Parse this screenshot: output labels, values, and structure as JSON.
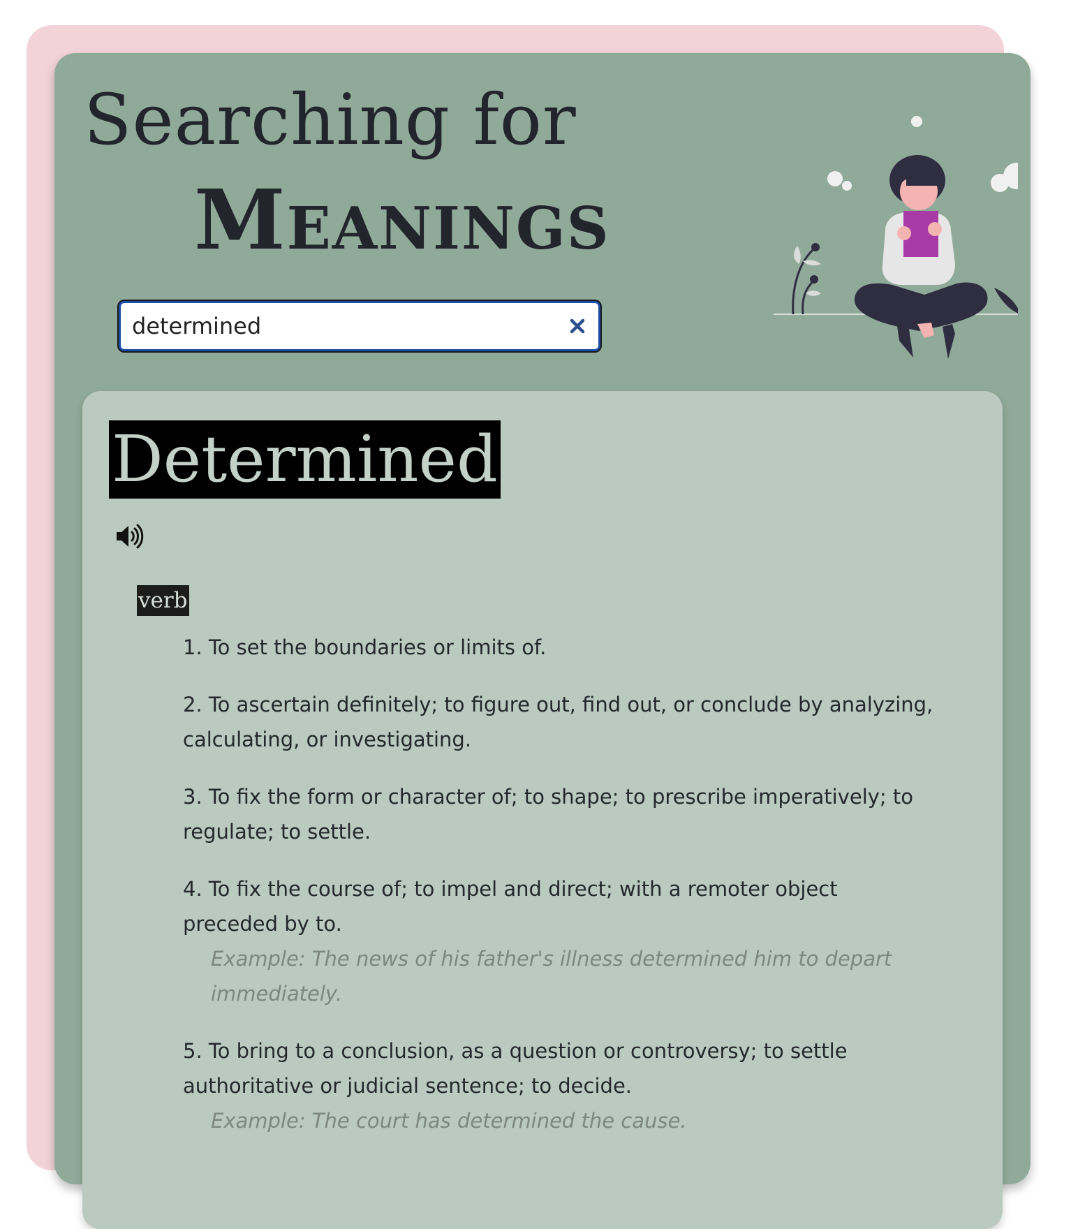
{
  "header": {
    "title_line1": "Searching for",
    "title_line2": "Meanings"
  },
  "search": {
    "value": "determined",
    "clear_icon": "close-icon"
  },
  "entry": {
    "word": "Determined",
    "audio_icon": "speaker-icon",
    "part_of_speech": "verb",
    "definitions": [
      {
        "text": "1. To set the boundaries or limits of.",
        "example": ""
      },
      {
        "text": "2. To ascertain definitely; to figure out, find out, or conclude by analyzing, calculating, or investigating.",
        "example": ""
      },
      {
        "text": "3. To fix the form or character of; to shape; to prescribe imperatively; to regulate; to settle.",
        "example": ""
      },
      {
        "text": "4. To fix the course of; to impel and direct; with a remoter object preceded by to.",
        "example": "Example: The news of his father's illness determined him to depart immediately."
      },
      {
        "text": "5. To bring to a conclusion, as a question or controversy; to settle authoritative or judicial sentence; to decide.",
        "example": "Example: The court has determined the cause."
      }
    ]
  },
  "colors": {
    "background_card": "#f2d3d8",
    "main_card": "#90aa9a",
    "definition_card": "#bacac0",
    "title_text": "#22252b",
    "search_border": "#1d4fa6"
  }
}
